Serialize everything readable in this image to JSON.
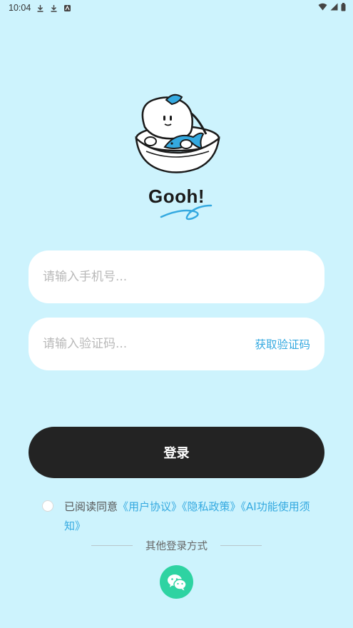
{
  "status_bar": {
    "time": "10:04",
    "left_icons": [
      "download-icon",
      "download-icon",
      "app-notification-icon"
    ],
    "right_icons": [
      "wifi-icon",
      "cellular-signal-icon",
      "battery-icon"
    ]
  },
  "brand": {
    "name": "Gooh!",
    "accent_color": "#34a9e0"
  },
  "form": {
    "phone_placeholder": "请输入手机号...",
    "phone_value": "",
    "code_placeholder": "请输入验证码...",
    "code_value": "",
    "get_code_label": "获取验证码"
  },
  "login_button": {
    "label": "登录"
  },
  "agreement": {
    "checked": false,
    "prefix": "已阅读同意",
    "user_agreement": "《用户协议》",
    "privacy_policy": "《隐私政策》",
    "ai_notice": "《AI功能使用须知》"
  },
  "other_login": {
    "label": "其他登录方式",
    "wechat_icon": "wechat-icon"
  },
  "colors": {
    "background": "#cdf3fd",
    "button": "#232323",
    "link": "#34a9e0",
    "wechat": "#2ed3a2"
  }
}
